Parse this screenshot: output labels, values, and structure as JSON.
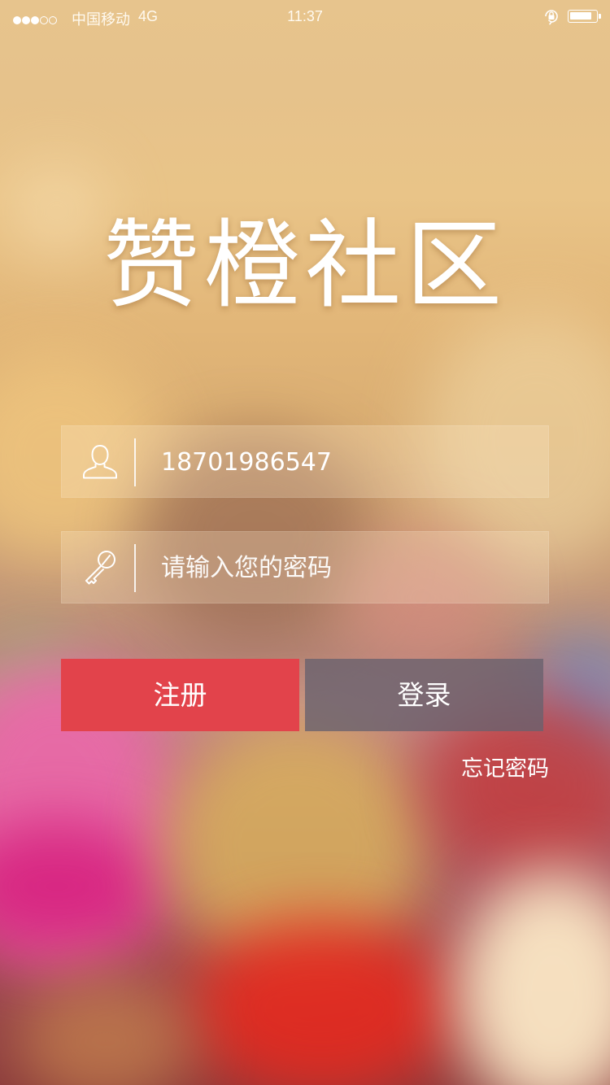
{
  "status_bar": {
    "signal_filled": 3,
    "signal_total": 5,
    "carrier": "中国移动",
    "network": "4G",
    "time": "11:37",
    "battery_level": 0.85,
    "icons": [
      "orientation-lock-icon",
      "battery-icon"
    ]
  },
  "app": {
    "title": "赞橙社区"
  },
  "login_form": {
    "username": {
      "icon": "user-icon",
      "value": "18701986547"
    },
    "password": {
      "icon": "key-icon",
      "placeholder": "请输入您的密码",
      "value": ""
    },
    "register_label": "注册",
    "login_label": "登录",
    "forgot_password_label": "忘记密码"
  },
  "colors": {
    "register_button": "#e2434b",
    "login_button": "#69626e"
  }
}
